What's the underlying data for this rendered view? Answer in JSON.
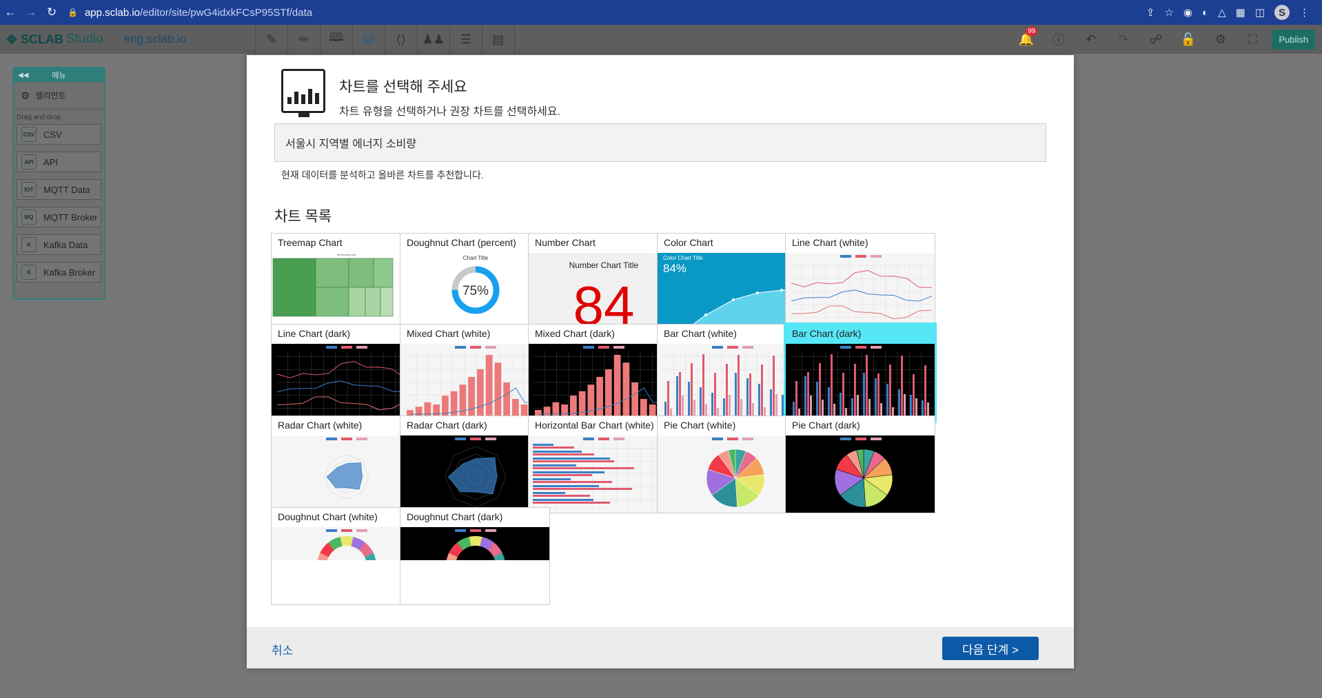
{
  "browser": {
    "url_host": "app.sclab.io",
    "url_path": "/editor/site/pwG4idxkFCsP95STf/data"
  },
  "app": {
    "logo_text": "SCLAB",
    "logo_suffix": "Studio",
    "site_name": "eng.sclab.io",
    "notification_count": "99",
    "publish_label": "Publish"
  },
  "sidebar": {
    "header": "메뉴",
    "element_label": "엘리먼트",
    "dragdrop_label": "Drag and drop",
    "items": [
      {
        "label": "CSV",
        "icon": "CSV"
      },
      {
        "label": "API",
        "icon": "API"
      },
      {
        "label": "MQTT Data",
        "icon": "IOT"
      },
      {
        "label": "MQTT Broker",
        "icon": "MQ"
      },
      {
        "label": "Kafka Data",
        "icon": "K"
      },
      {
        "label": "Kafka Broker",
        "icon": "K"
      }
    ]
  },
  "modal": {
    "title": "차트를 선택해 주세요",
    "subtitle": "차트 유형을 선택하거나 권장 차트를 선택하세요.",
    "data_value": "서울시 지역별 에너지 소비량",
    "hint": "현재 데이터를 분석하고 올바른 차트를 추천합니다.",
    "list_title": "차트 목록",
    "cancel_label": "취소",
    "next_label": "다음 단계 >",
    "number_chart_title": "Number Chart Title",
    "number_chart_value": "84",
    "color_chart_title": "Color Chart Title",
    "color_chart_value": "84%",
    "doughnut_title": "Chart Title",
    "doughnut_value": "75%",
    "treemap_title": "My treemap chart",
    "charts": [
      {
        "label": "Treemap Chart",
        "kind": "treemap"
      },
      {
        "label": "Doughnut Chart (percent)",
        "kind": "doughnut-percent"
      },
      {
        "label": "Number Chart",
        "kind": "number"
      },
      {
        "label": "Color Chart",
        "kind": "color"
      },
      {
        "label": "Line Chart (white)",
        "kind": "line-white"
      },
      {
        "label": "Line Chart (dark)",
        "kind": "line-dark"
      },
      {
        "label": "Mixed Chart (white)",
        "kind": "mixed-white"
      },
      {
        "label": "Mixed Chart (dark)",
        "kind": "mixed-dark"
      },
      {
        "label": "Bar Chart (white)",
        "kind": "bar-white"
      },
      {
        "label": "Bar Chart (dark)",
        "kind": "bar-dark",
        "selected": true
      },
      {
        "label": "Radar Chart (white)",
        "kind": "radar-white"
      },
      {
        "label": "Radar Chart (dark)",
        "kind": "radar-dark"
      },
      {
        "label": "Horizontal Bar Chart (white)",
        "kind": "hbar-white"
      },
      {
        "label": "Pie Chart (white)",
        "kind": "pie-white"
      },
      {
        "label": "Pie Chart (dark)",
        "kind": "pie-dark"
      },
      {
        "label": "Doughnut Chart (white)",
        "kind": "doughnut-white"
      },
      {
        "label": "Doughnut Chart (dark)",
        "kind": "doughnut-dark"
      }
    ]
  },
  "colors": {
    "accent_blue": "#0d5aa8",
    "selected_card": "#56e7f7",
    "series_blue": "#3a7fc6",
    "series_red": "#e05a6e",
    "number_red": "#e00000"
  }
}
